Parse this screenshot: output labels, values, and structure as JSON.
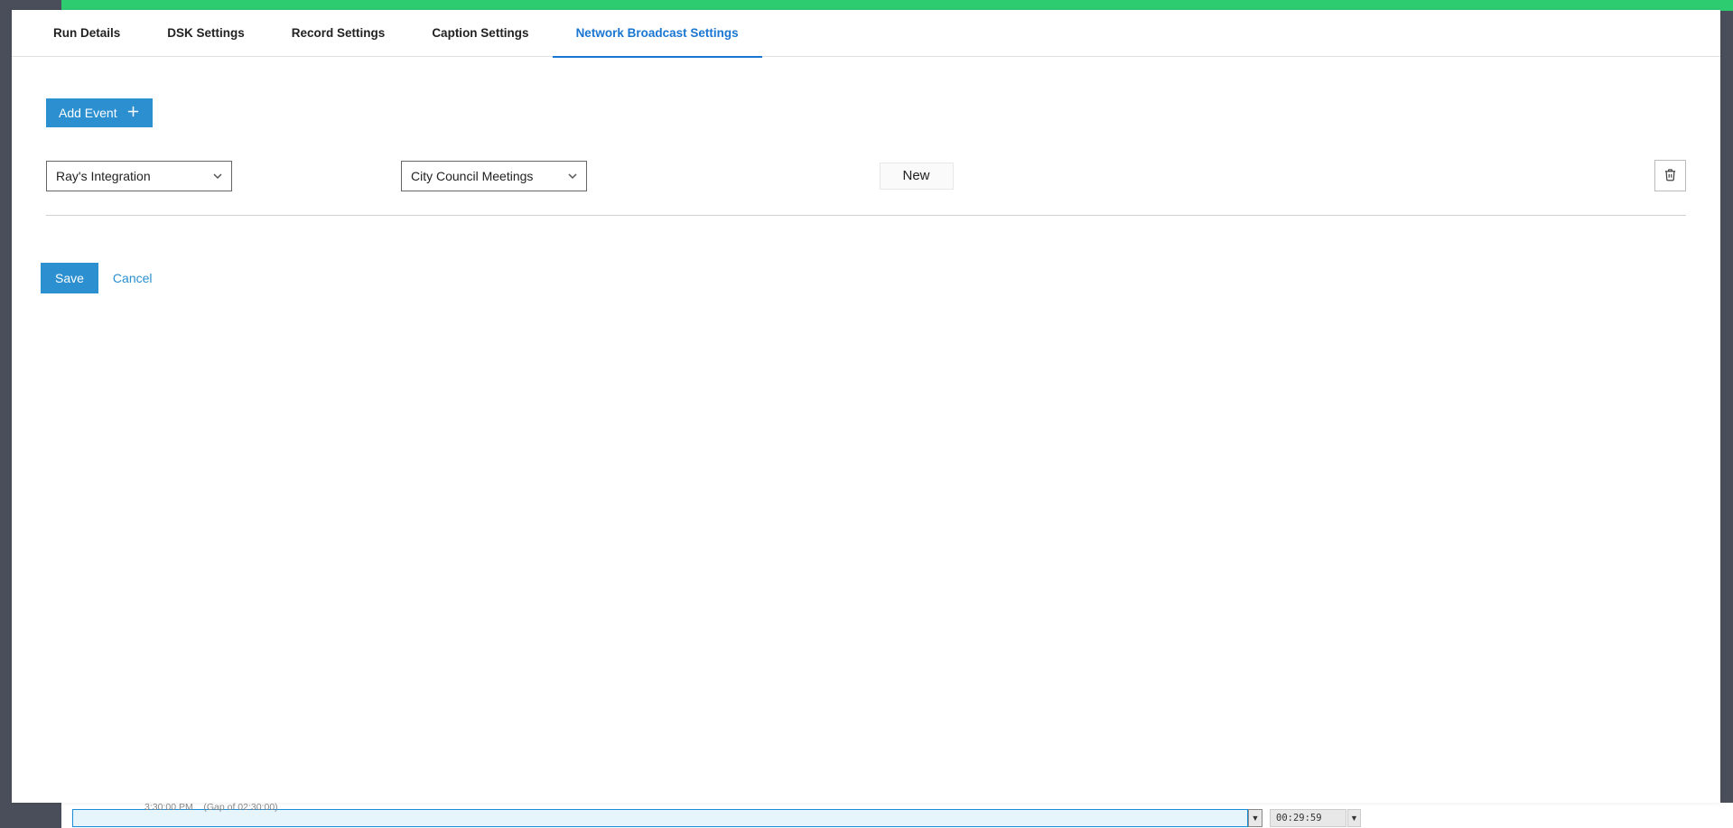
{
  "tabs": [
    {
      "label": "Run Details"
    },
    {
      "label": "DSK Settings"
    },
    {
      "label": "Record Settings"
    },
    {
      "label": "Caption Settings"
    },
    {
      "label": "Network Broadcast Settings",
      "active": true
    }
  ],
  "add_event_label": "Add Event",
  "row": {
    "integration": "Ray's Integration",
    "category": "City Council Meetings",
    "new_label": "New"
  },
  "actions": {
    "save": "Save",
    "cancel": "Cancel"
  },
  "background": {
    "time": "3:30:00 PM",
    "gap": "(Gap of 02:30:00)",
    "duration": "00:29:59"
  }
}
